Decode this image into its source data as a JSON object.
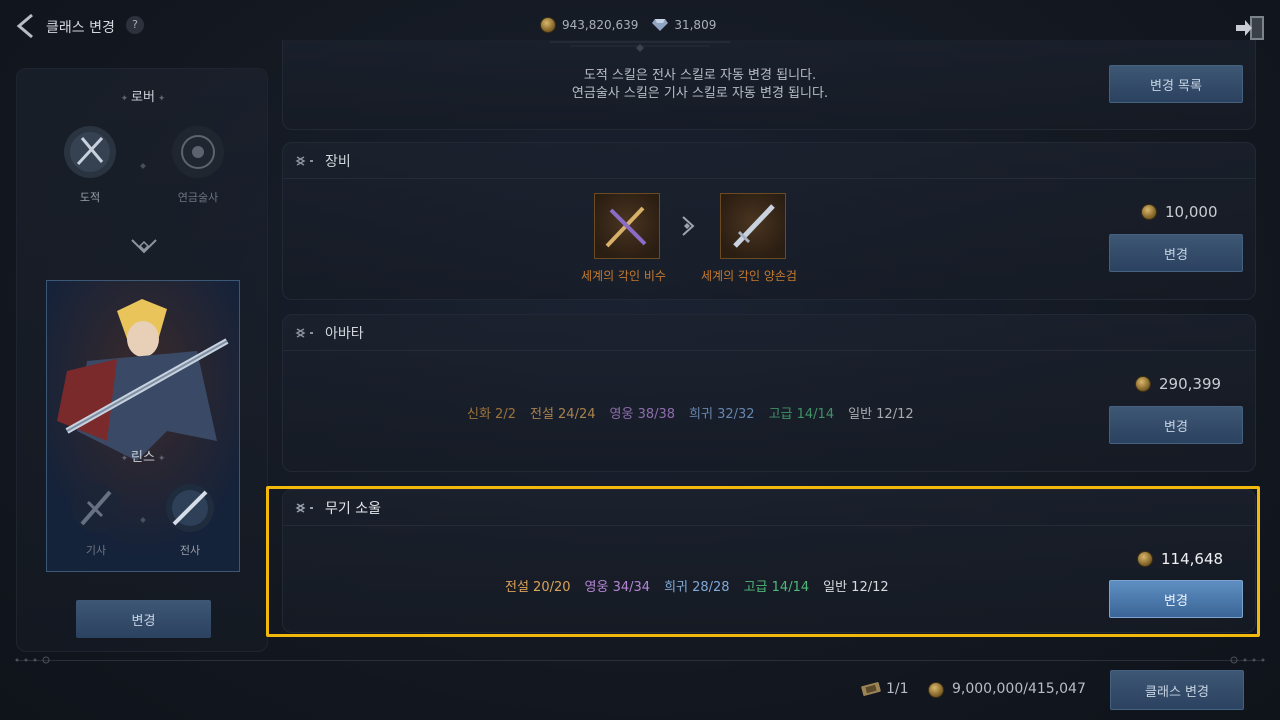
{
  "header": {
    "title": "클래스 변경",
    "help": "?",
    "gold": "943,820,639",
    "diamond": "31,809"
  },
  "left": {
    "current_class": "로버",
    "current_options": [
      "도적",
      "연금술사"
    ],
    "target_class": "린스",
    "target_options": [
      "기사",
      "전사"
    ],
    "change_label": "변경"
  },
  "notice": {
    "line1": "도적 스킬은 전사 스킬로 자동 변경 됩니다.",
    "line2": "연금술사 스킬은 기사 스킬로 자동 변경 됩니다.",
    "button": "변경 목록"
  },
  "equipment": {
    "title": "장비",
    "from_item": "세계의 각인 비수",
    "to_item": "세계의 각인 양손검",
    "cost": "10,000",
    "button": "변경"
  },
  "avatar": {
    "title": "아바타",
    "grades": [
      {
        "label": "신화 2/2",
        "tier": "myth"
      },
      {
        "label": "전설 24/24",
        "tier": "legend"
      },
      {
        "label": "영웅 38/38",
        "tier": "hero"
      },
      {
        "label": "희귀 32/32",
        "tier": "rare"
      },
      {
        "label": "고급 14/14",
        "tier": "adv"
      },
      {
        "label": "일반 12/12",
        "tier": "normal"
      }
    ],
    "cost": "290,399",
    "button": "변경"
  },
  "weapon_soul": {
    "title": "무기 소울",
    "grades": [
      {
        "label": "전설 20/20",
        "tier": "legend"
      },
      {
        "label": "영웅 34/34",
        "tier": "hero"
      },
      {
        "label": "희귀 28/28",
        "tier": "rare"
      },
      {
        "label": "고급 14/14",
        "tier": "adv"
      },
      {
        "label": "일반 12/12",
        "tier": "normal"
      }
    ],
    "cost": "114,648",
    "button": "변경"
  },
  "footer": {
    "tickets": "1/1",
    "gold_cost": "9,000,000/415,047",
    "class_change": "클래스 변경"
  },
  "colors": {
    "highlight": "#f2b90c",
    "button": "#2b4260",
    "button_active": "#5f8fc2"
  }
}
